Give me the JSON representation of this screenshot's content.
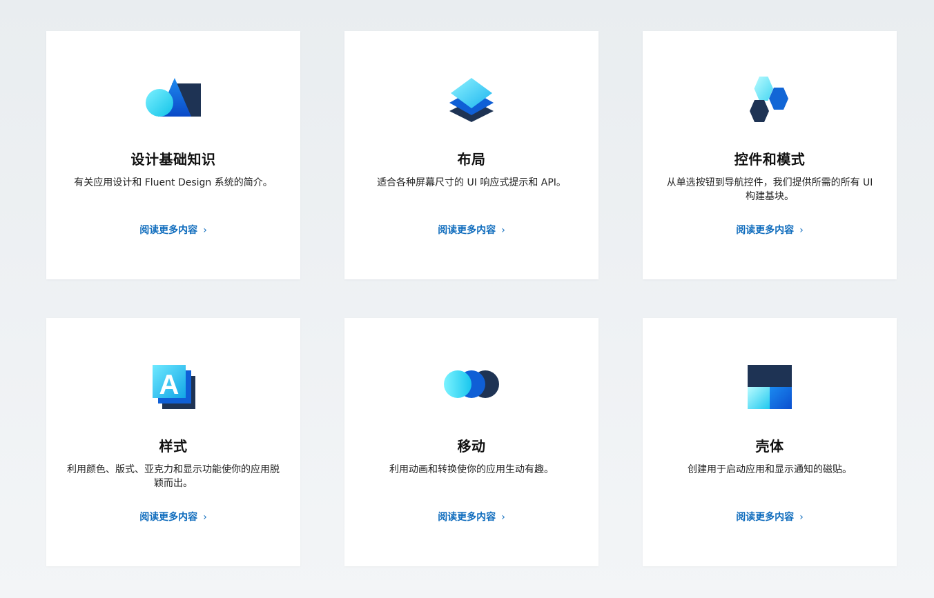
{
  "cards": [
    {
      "title": "设计基础知识",
      "description": "有关应用设计和 Fluent Design 系统的简介。",
      "link": "阅读更多内容",
      "icon": "shapes-icon"
    },
    {
      "title": "布局",
      "description": "适合各种屏幕尺寸的 UI 响应式提示和 API。",
      "link": "阅读更多内容",
      "icon": "layers-icon"
    },
    {
      "title": "控件和模式",
      "description": "从单选按钮到导航控件，我们提供所需的所有 UI 构建基块。",
      "link": "阅读更多内容",
      "icon": "hexagons-icon"
    },
    {
      "title": "样式",
      "description": "利用颜色、版式、亚克力和显示功能使你的应用脱颖而出。",
      "link": "阅读更多内容",
      "icon": "typography-icon",
      "icon_letter": "A"
    },
    {
      "title": "移动",
      "description": "利用动画和转换使你的应用生动有趣。",
      "link": "阅读更多内容",
      "icon": "motion-circles-icon"
    },
    {
      "title": "壳体",
      "description": "创建用于启动应用和显示通知的磁贴。",
      "link": "阅读更多内容",
      "icon": "tiles-icon"
    }
  ],
  "colors": {
    "link": "#0f6cbd",
    "dark_navy": "#1e3354",
    "blue": "#0f5fd6",
    "cyan": "#3ad6f5",
    "page_bg": "#eef1f3"
  }
}
